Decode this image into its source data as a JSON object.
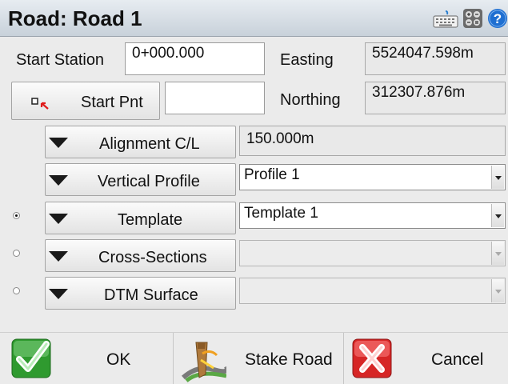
{
  "title": "Road: Road 1",
  "titlebar_icons": [
    "keyboard-icon",
    "calculator-icon",
    "help-icon"
  ],
  "form": {
    "start_station": {
      "label": "Start Station",
      "value": "0+000.000"
    },
    "easting": {
      "label": "Easting",
      "value": "5524047.598m"
    },
    "start_pnt": {
      "label": "Start Pnt",
      "value": ""
    },
    "northing": {
      "label": "Northing",
      "value": "312307.876m"
    },
    "alignment": {
      "label": "Alignment C/L",
      "value": "150.000m"
    },
    "vertical_profile": {
      "label": "Vertical Profile",
      "value": "Profile 1"
    },
    "template": {
      "label": "Template",
      "value": "Template 1",
      "selected": true
    },
    "cross_sections": {
      "label": "Cross-Sections",
      "value": "",
      "selected": false
    },
    "dtm_surface": {
      "label": "DTM Surface",
      "value": "",
      "selected": false
    }
  },
  "buttons": {
    "ok": "OK",
    "stake_road": "Stake Road",
    "cancel": "Cancel"
  },
  "colors": {
    "ok_icon": "#3aa83a",
    "cancel_icon": "#d62626",
    "help_icon": "#1f6fd1"
  }
}
